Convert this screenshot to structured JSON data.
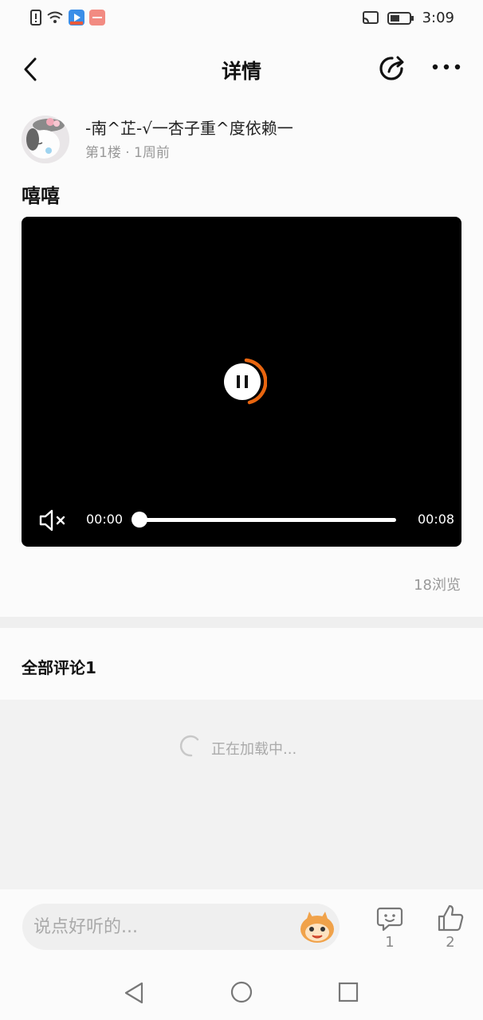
{
  "status_bar": {
    "time": "3:09"
  },
  "nav": {
    "title": "详情"
  },
  "post": {
    "author": "-南^芷-√一杏子重^度依赖一",
    "meta": "第1楼 · 1周前",
    "title": "嘻嘻",
    "views": "18浏览"
  },
  "video": {
    "current_time": "00:00",
    "total_time": "00:08",
    "progress": 0.0
  },
  "comments": {
    "header": "全部评论1",
    "loading_text": "正在加载中..."
  },
  "bottom": {
    "input_placeholder": "说点好听的...",
    "comment_count": "1",
    "like_count": "2"
  },
  "colors": {
    "accent_orange": "#e8650f"
  }
}
